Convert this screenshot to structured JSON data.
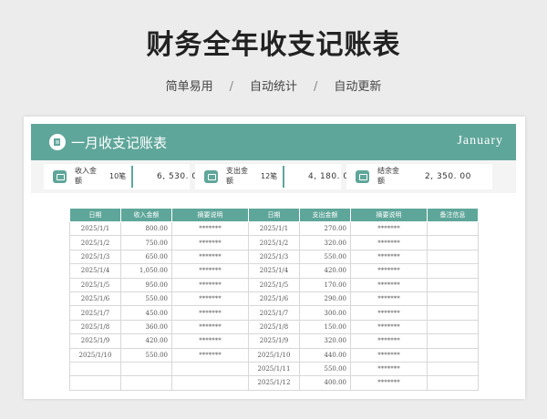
{
  "hero": {
    "title": "财务全年收支记账表",
    "tags": [
      "简单易用",
      "自动统计",
      "自动更新"
    ],
    "separator": "/"
  },
  "sheet": {
    "title": "一月收支记账表",
    "month": "January",
    "accent_color": "#5fa69a"
  },
  "summary": {
    "income": {
      "label": "收入金额",
      "count": "10笔",
      "amount": "6, 530. 00",
      "icon": "wallet-icon"
    },
    "expense": {
      "label": "支出金额",
      "count": "12笔",
      "amount": "4, 180. 00",
      "icon": "wallet-icon"
    },
    "balance": {
      "label": "结余金额",
      "amount": "2, 350. 00",
      "icon": "wallet-icon"
    }
  },
  "table": {
    "headers": [
      "日期",
      "收入金额",
      "摘要说明",
      "日期",
      "支出金额",
      "摘要说明",
      "备注信息"
    ],
    "income_rows": [
      [
        "2025/1/1",
        "800.00",
        "*******"
      ],
      [
        "2025/1/2",
        "750.00",
        "*******"
      ],
      [
        "2025/1/3",
        "650.00",
        "*******"
      ],
      [
        "2025/1/4",
        "1,050.00",
        "*******"
      ],
      [
        "2025/1/5",
        "950.00",
        "*******"
      ],
      [
        "2025/1/6",
        "550.00",
        "*******"
      ],
      [
        "2025/1/7",
        "450.00",
        "*******"
      ],
      [
        "2025/1/8",
        "360.00",
        "*******"
      ],
      [
        "2025/1/9",
        "420.00",
        "*******"
      ],
      [
        "2025/1/10",
        "550.00",
        "*******"
      ],
      [
        "",
        "",
        ""
      ],
      [
        "",
        "",
        ""
      ]
    ],
    "expense_rows": [
      [
        "2025/1/1",
        "270.00",
        "*******"
      ],
      [
        "2025/1/2",
        "320.00",
        "*******"
      ],
      [
        "2025/1/3",
        "550.00",
        "*******"
      ],
      [
        "2025/1/4",
        "420.00",
        "*******"
      ],
      [
        "2025/1/5",
        "170.00",
        "*******"
      ],
      [
        "2025/1/6",
        "290.00",
        "*******"
      ],
      [
        "2025/1/7",
        "300.00",
        "*******"
      ],
      [
        "2025/1/8",
        "150.00",
        "*******"
      ],
      [
        "2025/1/9",
        "320.00",
        "*******"
      ],
      [
        "2025/1/10",
        "440.00",
        "*******"
      ],
      [
        "2025/1/11",
        "550.00",
        "*******"
      ],
      [
        "2025/1/12",
        "400.00",
        "*******"
      ]
    ]
  }
}
